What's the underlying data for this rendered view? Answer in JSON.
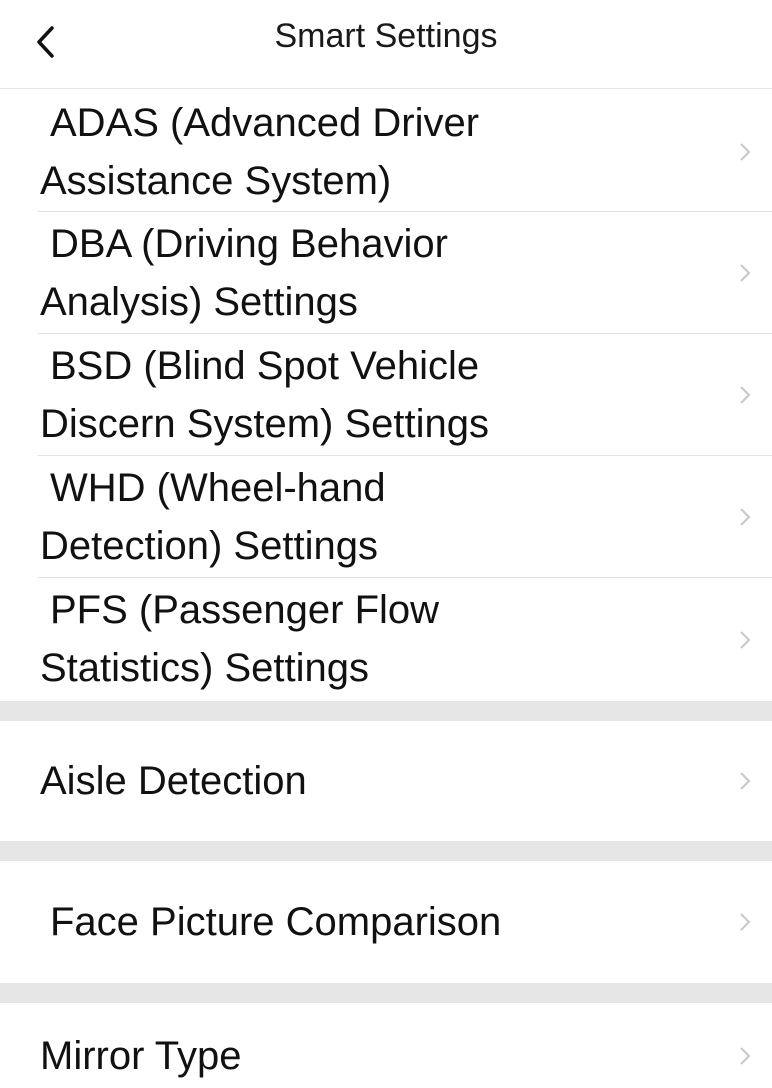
{
  "header": {
    "title": "Smart Settings",
    "back_icon": "chevron-left-icon"
  },
  "group1": [
    {
      "label_line1": "ADAS (Advanced Driver",
      "label_line2": "Assistance System)"
    },
    {
      "label_line1": "DBA (Driving Behavior",
      "label_line2": "Analysis) Settings"
    },
    {
      "label_line1": "BSD (Blind Spot Vehicle",
      "label_line2": "Discern System) Settings"
    },
    {
      "label_line1": "WHD (Wheel-hand",
      "label_line2": "Detection) Settings"
    },
    {
      "label_line1": "PFS (Passenger Flow",
      "label_line2": "Statistics) Settings"
    }
  ],
  "aisle_detection": {
    "label": "Aisle Detection"
  },
  "face_picture_comparison": {
    "label": "Face Picture Comparison"
  },
  "mirror_type": {
    "label": "Mirror Type"
  },
  "colors": {
    "background": "#ffffff",
    "section_gap": "#e6e6e6",
    "divider": "#e3e3e3",
    "chevron": "#c8c8c8",
    "text": "#111111"
  },
  "icons": {
    "row_chevron": "chevron-right-icon"
  }
}
